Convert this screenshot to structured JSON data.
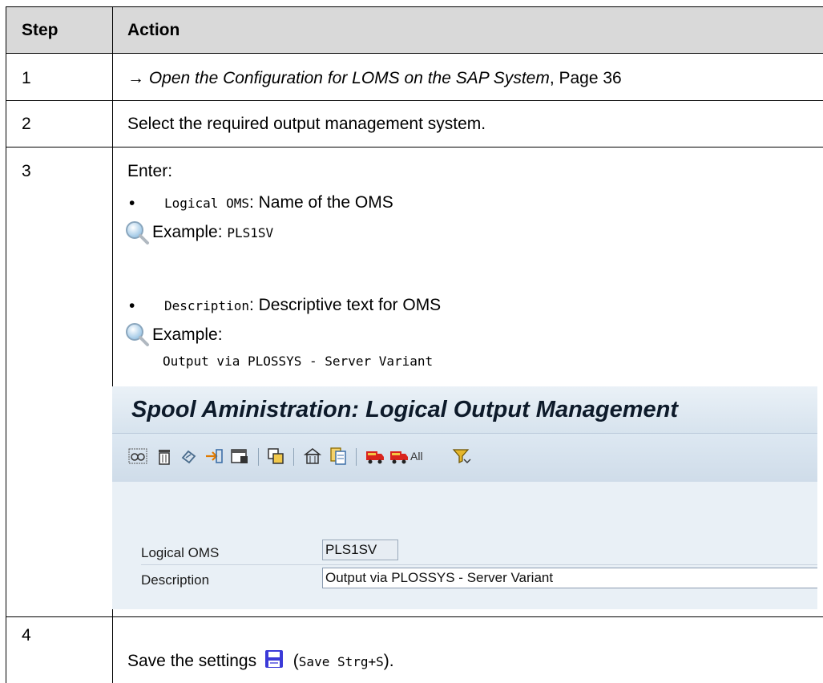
{
  "table": {
    "headers": {
      "step": "Step",
      "action": "Action"
    },
    "rows": [
      {
        "step": "1",
        "arrow": "→ ",
        "link_text": "Open the Configuration for LOMS on the SAP System",
        "suffix": ", Page 36"
      },
      {
        "step": "2",
        "text": "Select the required output management system."
      },
      {
        "step": "3",
        "intro": "Enter:",
        "bullet": "•",
        "items": [
          {
            "field": "Logical OMS",
            "desc": ": Name of the OMS",
            "example_label": "Example: ",
            "example_value": "PLS1SV"
          },
          {
            "field": "Description",
            "desc": ": Descriptive text for OMS",
            "example_label": "Example:",
            "example_value": "Output via PLOSSYS - Server Variant"
          }
        ]
      },
      {
        "step": "4",
        "text_before": "Save the settings",
        "paren_open": "(",
        "shortcut": "Save Strg+S",
        "paren_close": ")."
      }
    ]
  },
  "sap_screen": {
    "title": "Spool Aministration: Logical Output Management",
    "toolbar_all_label": "All",
    "toolbar_icons": [
      "glasses-icon",
      "trash-icon",
      "undo-icon",
      "transport-icon",
      "table-settings-icon",
      "copy-objects-icon",
      "wizard-icon",
      "documents-icon",
      "truck-icon",
      "truck-all-icon",
      "filter-icon"
    ],
    "form": {
      "logical_oms_label": "Logical OMS",
      "logical_oms_value": "PLS1SV",
      "description_label": "Description",
      "description_value": "Output via PLOSSYS - Server Variant"
    }
  },
  "colors": {
    "header_bg": "#d9d9d9",
    "sap_bg": "#e9f0f6",
    "save_icon": "#3b3ad8"
  }
}
